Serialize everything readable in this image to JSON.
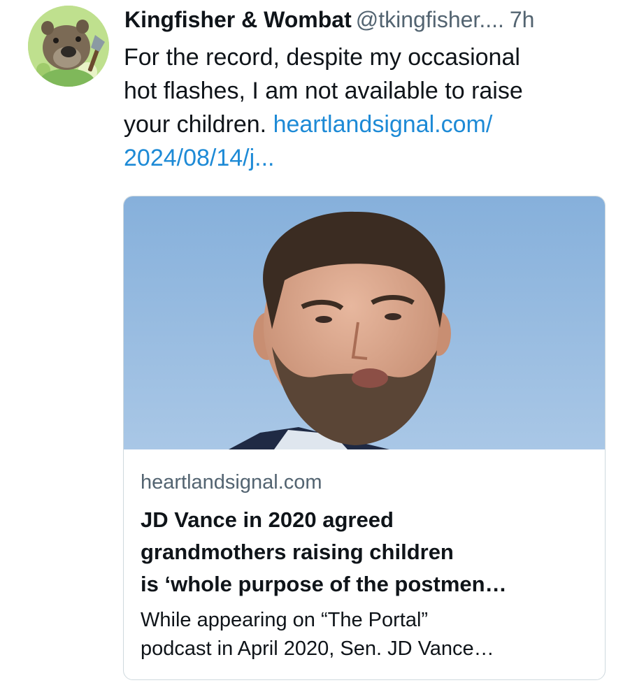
{
  "author": {
    "display_name": "Kingfisher & Wombat",
    "handle": "@tkingfisher....",
    "time_ago": "7h",
    "avatar": "wombat-avatar-icon"
  },
  "post": {
    "text_line1": "For the record, despite my occasional",
    "text_line2": "hot flashes, I am not available to raise",
    "text_line3": "your children.",
    "link_part1": "heartlandsignal.com/",
    "link_part2": "2024/08/14/j..."
  },
  "card": {
    "image": "man-photo",
    "domain": "heartlandsignal.com",
    "title_line1": "JD Vance in 2020 agreed",
    "title_line2": "grandmothers raising children",
    "title_line3": "is ‘whole purpose of the postmen…",
    "desc_line1": "While appearing on “The Portal”",
    "desc_line2": "podcast in April 2020, Sen. JD Vance…"
  },
  "colors": {
    "link": "#1d8ad6",
    "secondary_text": "#536471",
    "sky": "#8fb6de",
    "card_border": "#cfd9de"
  }
}
